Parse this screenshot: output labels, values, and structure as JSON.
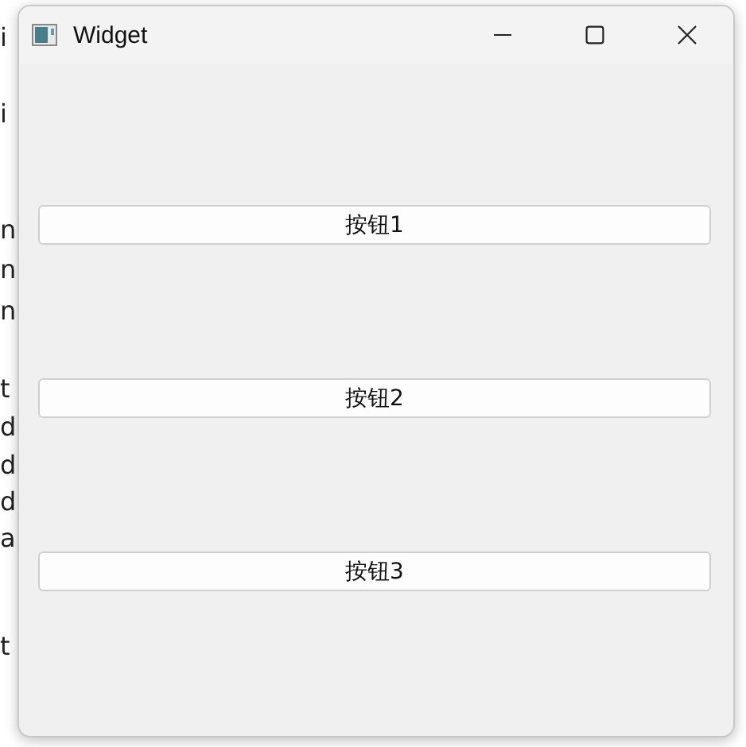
{
  "background_editor": {
    "lines": [
      "i",
      "i",
      "n",
      "n",
      "n",
      "t",
      "d",
      "d",
      "d",
      "a",
      "t"
    ]
  },
  "window": {
    "title": "Widget"
  },
  "buttons": [
    {
      "label": "按钮1"
    },
    {
      "label": "按钮2"
    },
    {
      "label": "按钮3"
    }
  ]
}
